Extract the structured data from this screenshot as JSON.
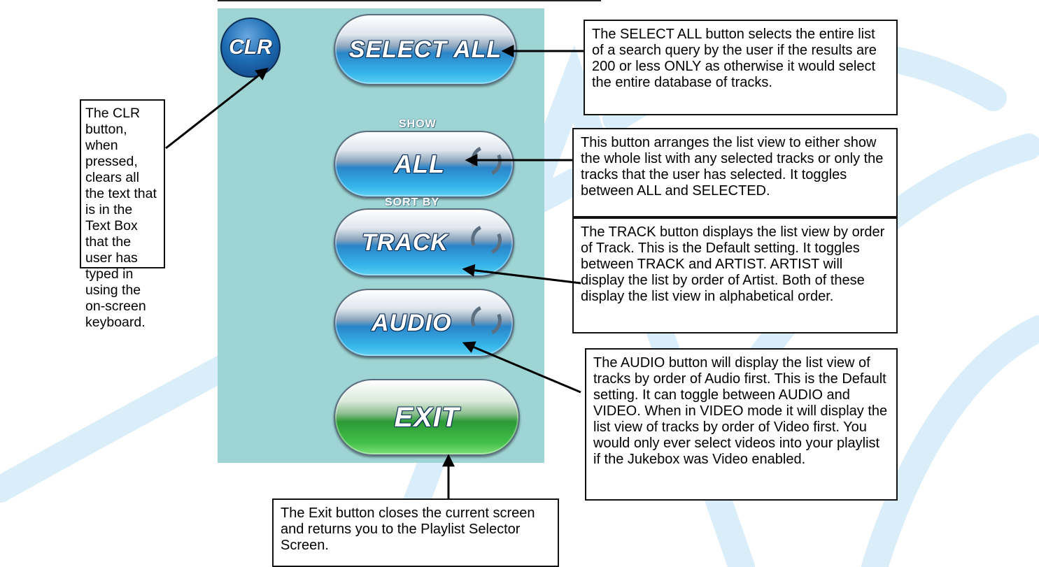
{
  "colors": {
    "panel_bg": "#9fd4d5",
    "blue_button": "#35b6ea",
    "green_button": "#44c14a",
    "clr_button": "#1f6fb6",
    "watermark": "#d6ecfa"
  },
  "panel": {
    "clr_label": "CLR",
    "select_all_label": "SELECT ALL",
    "show_label": "SHOW",
    "show_button_label": "ALL",
    "sort_by_label": "SORT BY",
    "sort_button_label": "TRACK",
    "media_button_label": "AUDIO",
    "exit_label": "EXIT",
    "toggle_icon": "refresh-icon"
  },
  "callouts": {
    "clr": "The CLR button, when pressed, clears all the text that is in the Text Box that the user has typed in using the on-screen keyboard.",
    "select_all": "The SELECT ALL button selects the entire list of a search query by the user if the results are 200 or less ONLY as otherwise it would select the entire database of tracks.",
    "show": "This button arranges the list view to either show the whole list with any selected tracks or only the tracks that the user has selected. It toggles between ALL and SELECTED.",
    "track": "The TRACK button displays the list view by order of Track. This is the Default setting. It toggles between TRACK and ARTIST. ARTIST will display the list by order of Artist. Both of these display the list view in alphabetical order.",
    "audio": "The AUDIO button will display the list view of tracks by order of Audio first. This is the Default setting. It can toggle between AUDIO and VIDEO. When in VIDEO mode it will display the list view of tracks by order of Video first. You would only ever select videos into your playlist if the Jukebox was Video enabled.",
    "exit": "The Exit button closes the current screen and returns you to the Playlist Selector Screen."
  }
}
